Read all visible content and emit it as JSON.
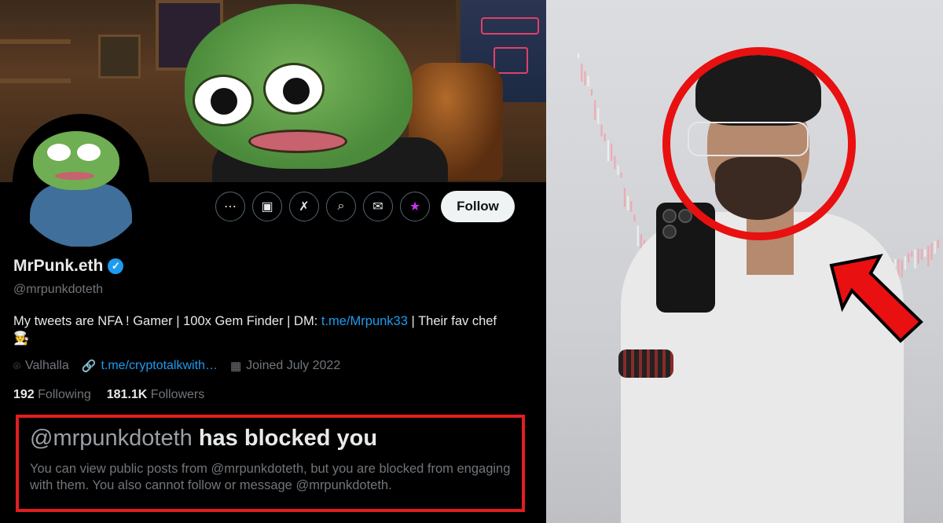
{
  "profile": {
    "display_name": "MrPunk.eth",
    "verified_glyph": "✓",
    "handle": "@mrpunkdoteth",
    "bio_text": "My tweets are NFA ! Gamer | 100x Gem Finder | DM: ",
    "bio_link": "t.me/Mrpunk33",
    "bio_suffix": " | Their fav chef",
    "bio_emoji": "🧑‍🍳",
    "location": "Valhalla",
    "website": "t.me/cryptotalkwith…",
    "joined": "Joined July 2022",
    "following_count": "192",
    "following_label": "Following",
    "followers_count": "181.1K",
    "followers_label": "Followers"
  },
  "actions": {
    "more_icon": "more-icon",
    "more_glyph": "⋯",
    "subscribe_icon": "subscribe-icon",
    "subscribe_glyph": "▣",
    "grok_icon": "grok-icon",
    "grok_glyph": "✗",
    "search_icon": "search-icon",
    "search_glyph": "⌕",
    "message_icon": "message-icon",
    "message_glyph": "✉",
    "follow_icon": "follow-user-icon",
    "follow_glyph": "★",
    "follow_label": "Follow"
  },
  "meta_icons": {
    "location": "⌾",
    "link": "🔗",
    "calendar": "▦"
  },
  "blocked_notice": {
    "handle": "@mrpunkdoteth",
    "title_suffix": " has blocked you",
    "body": "You can view public posts from  @mrpunkdoteth, but you are blocked from engaging with them. You also cannot follow or message  @mrpunkdoteth."
  },
  "colors": {
    "accent_blue": "#1d9bf0",
    "highlight_red": "#e81010",
    "follow_bg": "#eff3f4",
    "muted": "#71767b"
  }
}
